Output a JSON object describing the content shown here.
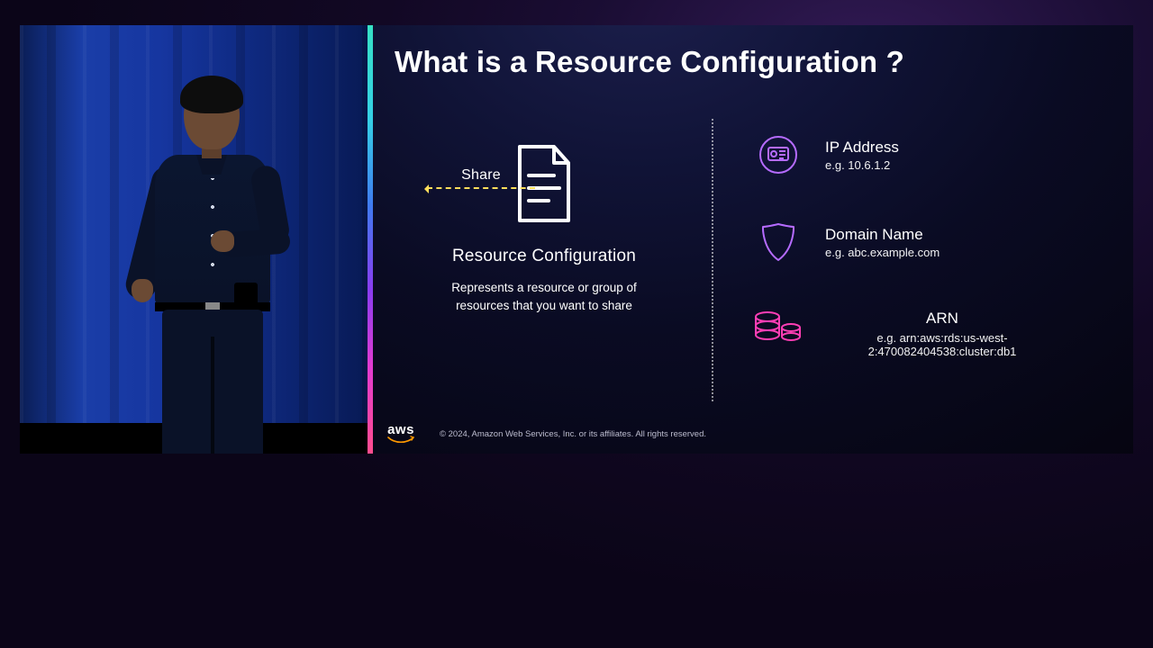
{
  "slide": {
    "title": "What is a Resource Configuration ?",
    "left": {
      "share_label": "Share",
      "heading": "Resource Configuration",
      "subtext": "Represents a resource or group of resources that you want to share"
    },
    "items": [
      {
        "title": "IP Address",
        "example": "e.g. 10.6.1.2"
      },
      {
        "title": "Domain Name",
        "example": "e.g. abc.example.com"
      },
      {
        "title": "ARN",
        "example": "e.g. arn:aws:rds:us-west-2:470082404538:cluster:db1"
      }
    ],
    "footer": {
      "logo_text": "aws",
      "copyright": "© 2024, Amazon Web Services, Inc. or its affiliates. All rights reserved."
    }
  },
  "colors": {
    "outline_purple": "#b56bff",
    "outline_magenta": "#ff3eb5"
  }
}
